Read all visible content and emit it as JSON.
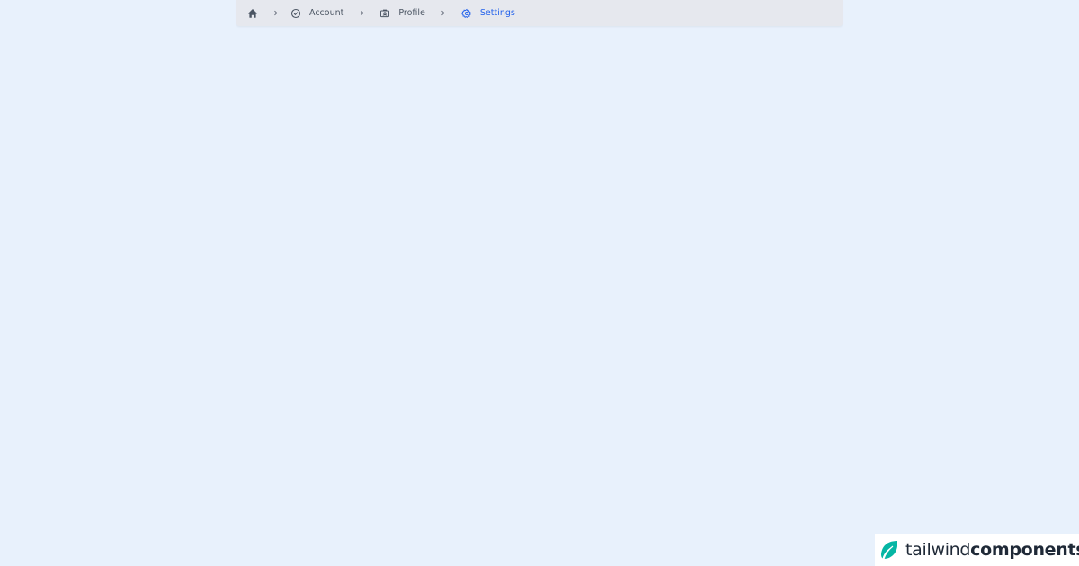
{
  "breadcrumb": {
    "items": [
      {
        "label": "",
        "icon": "home-icon"
      },
      {
        "label": "Account",
        "icon": "check-circle-icon"
      },
      {
        "label": "Profile",
        "icon": "id-card-icon"
      },
      {
        "label": "Settings",
        "icon": "gear-icon",
        "active": true
      }
    ],
    "separator_icon": "chevron-right-icon"
  },
  "brand": {
    "light": "tailwind",
    "bold": "components",
    "icon": "leaf-icon"
  },
  "colors": {
    "background": "#e8f1fc",
    "bar": "#e6e8ee",
    "text": "#4b5563",
    "active": "#2563eb",
    "brand_accent": "#06b6a4"
  }
}
